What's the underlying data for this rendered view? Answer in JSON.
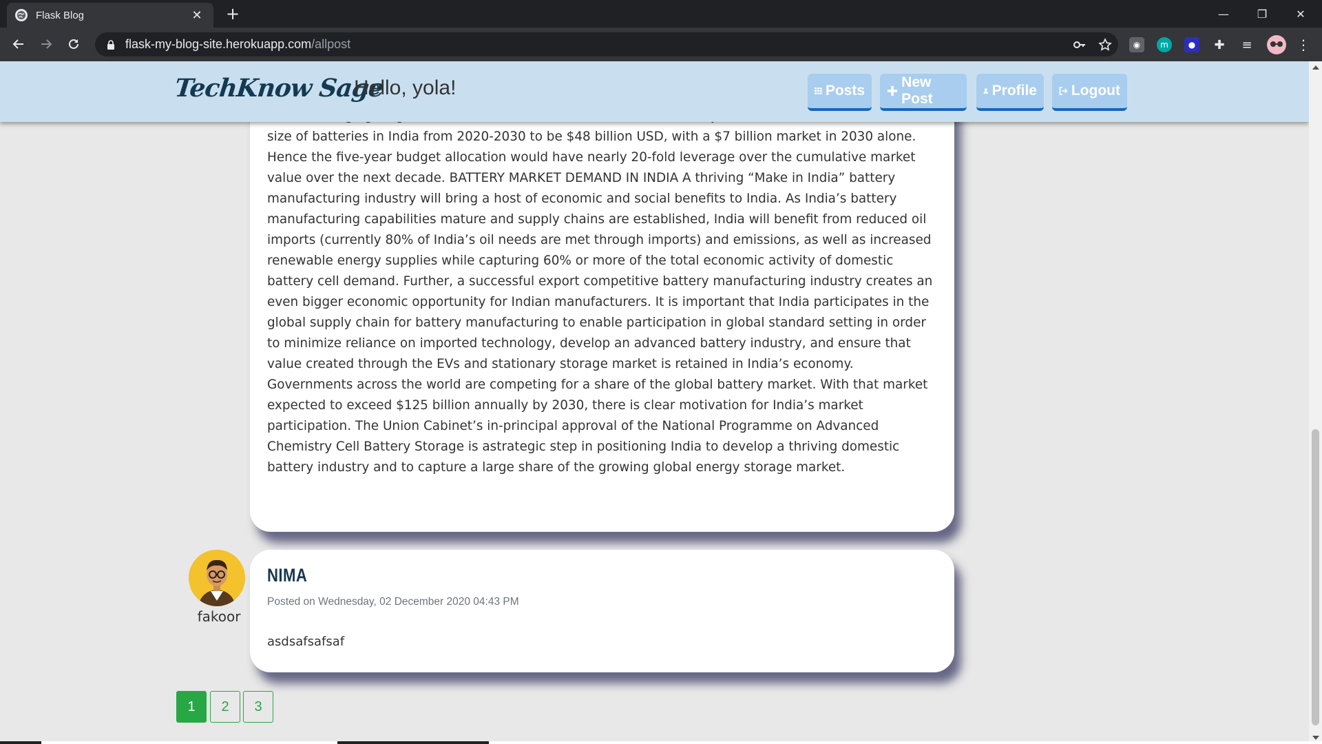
{
  "browser": {
    "tab_title": "Flask Blog",
    "tab_close": "✕",
    "new_tab": "+",
    "url_host": "flask-my-blog-site.herokuapp.com",
    "url_path": "/allpost",
    "window_controls": [
      "—",
      "❐",
      "✕"
    ],
    "ext_m_label": "m"
  },
  "site": {
    "brand": "TechKnow Sage",
    "greeting": "Hello, yola!",
    "nav": [
      {
        "label": "Posts",
        "icon": "grid-icon"
      },
      {
        "label": "New Post",
        "icon": "plus-icon"
      },
      {
        "label": "Profile",
        "icon": "user-icon"
      },
      {
        "label": "Logout",
        "icon": "logout-icon"
      }
    ]
  },
  "posts": [
    {
      "body": "shares of renewable energy generation and electrification of the transportation sector. While an outlay of more than USD $2.5 billion may seem large, it is the magnitude required to have a catalytic effect on the market, bringing long-term economic value to India. We conservatively estimate the cumulative market size of batteries in India from 2020-2030 to be $48 billion USD, with a $7 billion market in 2030 alone. Hence the five-year budget allocation would have nearly 20-fold leverage over the cumulative market value over the next decade. BATTERY MARKET DEMAND IN INDIA A thriving “Make in India” battery manufacturing industry will bring a host of economic and social benefits to India. As India’s battery manufacturing capabilities mature and supply chains are established, India will benefit from reduced oil imports (currently 80% of India’s oil needs are met through imports) and emissions, as well as increased renewable energy supplies while capturing 60% or more of the total economic activity of domestic battery cell demand. Further, a successful export competitive battery manufacturing industry creates an even bigger economic opportunity for Indian manufacturers. It is important that India participates in the global supply chain for battery manufacturing to enable participation in global standard setting in order to minimize reliance on imported technology, develop an advanced battery industry, and ensure that value created through the EVs and stationary storage market is retained in India’s economy. Governments across the world are competing for a share of the global battery market. With that market expected to exceed $125 billion annually by 2030, there is clear motivation for India’s market participation. The Union Cabinet’s in-principal approval of the National Programme on Advanced Chemistry Cell Battery Storage is astrategic step in positioning India to develop a thriving domestic battery industry and to capture a large share of the growing global energy storage market."
    },
    {
      "title": "NIMA",
      "meta": "Posted on Wednesday, 02 December 2020 04:43 PM",
      "author": "fakoor",
      "content": "asdsafsafsaf"
    }
  ],
  "pagination": {
    "pages": [
      "1",
      "2",
      "3"
    ],
    "current": "1"
  },
  "colors": {
    "nav_bg": "#c9dff0",
    "nav_button": "#a8cdee",
    "nav_button_border": "#1565c0",
    "brand": "#143a52",
    "pager": "#28a745"
  }
}
